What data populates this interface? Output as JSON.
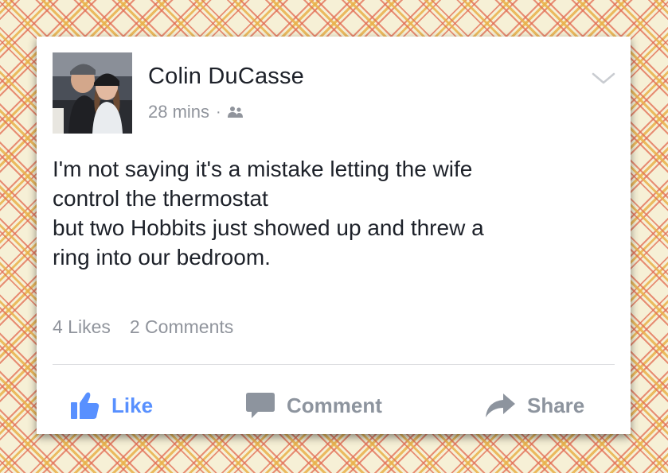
{
  "post": {
    "author": {
      "name": "Colin DuCasse",
      "avatar_icon": "profile-photo-couple"
    },
    "timestamp": "28 mins",
    "meta_separator": "·",
    "audience_icon": "friends-icon",
    "menu_icon": "chevron-down-icon",
    "text_lines": [
      "I'm not saying it's a mistake letting the wife",
      "control the thermostat",
      "but two Hobbits just showed up and threw a",
      "ring into our bedroom."
    ],
    "stats": {
      "likes": "4 Likes",
      "comments": "2 Comments"
    }
  },
  "actions": {
    "like": {
      "label": "Like",
      "icon": "thumbs-up-icon",
      "color": "#5890ff"
    },
    "comment": {
      "label": "Comment",
      "icon": "speech-bubble-icon",
      "color": "#8d949e"
    },
    "share": {
      "label": "Share",
      "icon": "share-arrow-icon",
      "color": "#8d949e"
    }
  },
  "colors": {
    "card_background": "#ffffff",
    "name_text": "#1d2129",
    "meta_text": "#90949c",
    "accent": "#5890ff",
    "plaid_orange": "#e26c52",
    "plaid_yellow": "#e9b04a",
    "plaid_cream": "#f6f0d6"
  }
}
